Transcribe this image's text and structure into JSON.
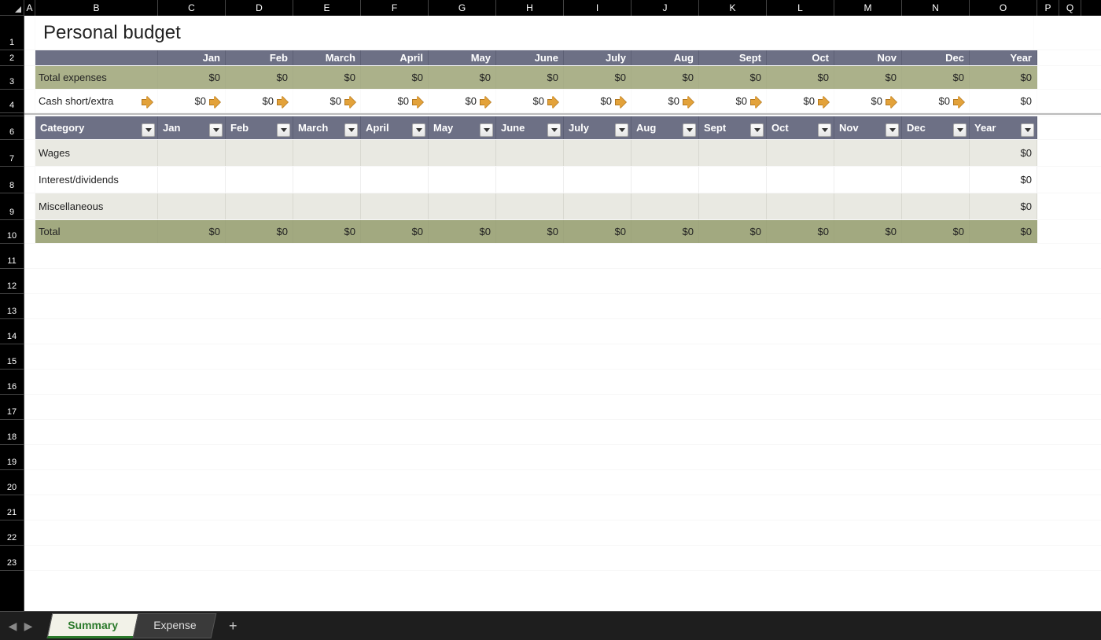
{
  "columns": [
    "A",
    "B",
    "C",
    "D",
    "E",
    "F",
    "G",
    "H",
    "I",
    "J",
    "K",
    "L",
    "M",
    "N",
    "O",
    "P",
    "Q"
  ],
  "row_heights": {
    "r1": 44,
    "r2": 20,
    "r3": 30,
    "r4": 30,
    "r_gap": 4,
    "r6": 30,
    "r7": 34,
    "r8": 34,
    "r9": 34,
    "r10": 30,
    "empty": 32
  },
  "title": "Personal budget",
  "months": [
    "Jan",
    "Feb",
    "March",
    "April",
    "May",
    "June",
    "July",
    "Aug",
    "Sept",
    "Oct",
    "Nov",
    "Dec",
    "Year"
  ],
  "summary": {
    "expenses_label": "Total expenses",
    "expenses": [
      "$0",
      "$0",
      "$0",
      "$0",
      "$0",
      "$0",
      "$0",
      "$0",
      "$0",
      "$0",
      "$0",
      "$0",
      "$0"
    ],
    "cash_label": "Cash short/extra",
    "cash": [
      "$0",
      "$0",
      "$0",
      "$0",
      "$0",
      "$0",
      "$0",
      "$0",
      "$0",
      "$0",
      "$0",
      "$0",
      "$0"
    ]
  },
  "filters": {
    "category_label": "Category",
    "headers": [
      "Jan",
      "Feb",
      "March",
      "April",
      "May",
      "June",
      "July",
      "Aug",
      "Sept",
      "Oct",
      "Nov",
      "Dec",
      "Year"
    ]
  },
  "categories": [
    {
      "name": "Wages",
      "values": [
        "",
        "",
        "",
        "",
        "",
        "",
        "",
        "",
        "",
        "",
        "",
        "",
        "$0"
      ]
    },
    {
      "name": "Interest/dividends",
      "values": [
        "",
        "",
        "",
        "",
        "",
        "",
        "",
        "",
        "",
        "",
        "",
        "",
        "$0"
      ]
    },
    {
      "name": "Miscellaneous",
      "values": [
        "",
        "",
        "",
        "",
        "",
        "",
        "",
        "",
        "",
        "",
        "",
        "",
        "$0"
      ]
    }
  ],
  "total_row": {
    "label": "Total",
    "values": [
      "$0",
      "$0",
      "$0",
      "$0",
      "$0",
      "$0",
      "$0",
      "$0",
      "$0",
      "$0",
      "$0",
      "$0",
      "$0"
    ]
  },
  "empty_rows": [
    "11",
    "12",
    "13",
    "14",
    "15",
    "16",
    "17",
    "18",
    "19",
    "20",
    "21",
    "22",
    "23"
  ],
  "tabs": {
    "items": [
      {
        "label": "Summary",
        "active": true
      },
      {
        "label": "Expense",
        "active": false
      }
    ]
  }
}
